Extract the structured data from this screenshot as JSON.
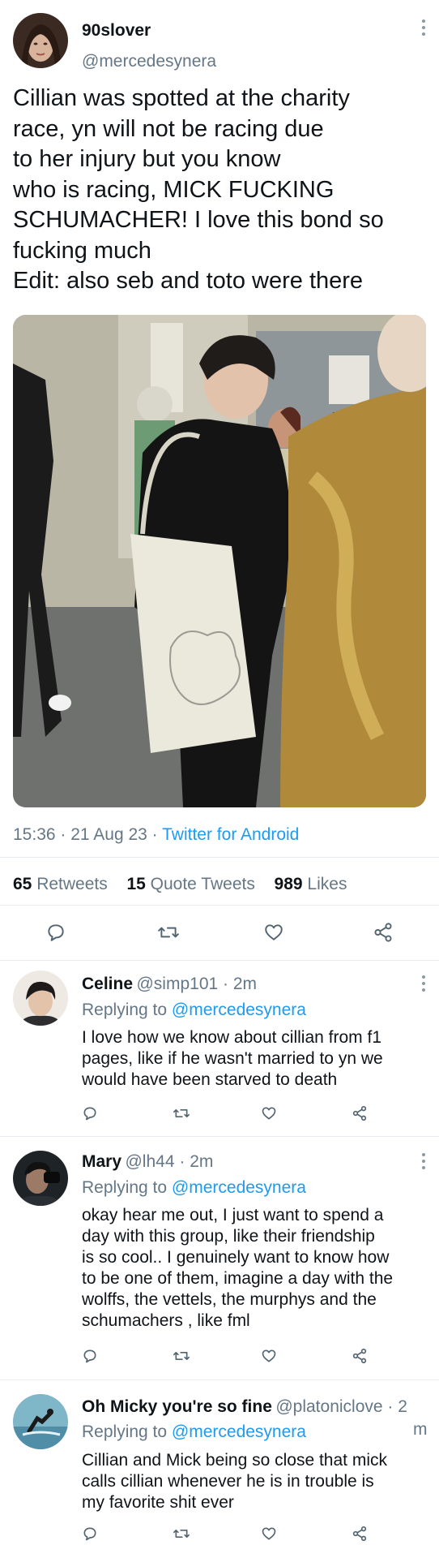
{
  "tweet": {
    "display_name": "90slover",
    "handle": "@mercedesynera",
    "text_lines": [
      "Cillian was spotted at the charity",
      "race, yn will not be racing due",
      "to her injury but you know",
      "who is racing, MICK FUCKING",
      "SCHUMACHER! I love this bond so",
      "fucking much",
      "Edit: also seb and toto were there"
    ],
    "time": "15:36",
    "date": "21 Aug 23",
    "source": "Twitter for Android",
    "retweets": "65",
    "retweets_label": "Retweets",
    "quotes": "15",
    "quotes_label": "Quote Tweets",
    "likes": "989",
    "likes_label": "Likes"
  },
  "replies": [
    {
      "name": "Celine",
      "handle": "@simp101",
      "time": "2m",
      "replying_label": "Replying to",
      "replying_to": "@mercedesynera",
      "lines": [
        "I love how we know about cillian from f1",
        "pages, like if he wasn't married to yn we",
        "would have been starved to death"
      ]
    },
    {
      "name": "Mary",
      "handle": "@lh44",
      "time": "2m",
      "replying_label": "Replying to",
      "replying_to": "@mercedesynera",
      "lines": [
        "okay hear me out, I just want to spend a",
        "day with this group, like their friendship",
        "is so cool.. I genuinely want to know how",
        "to be one of them, imagine a day with the",
        "wolffs, the vettels, the murphys and the",
        "schumachers , like fml"
      ]
    },
    {
      "name": "Oh Micky you're so fine",
      "handle": "@platoniclove",
      "time": "2",
      "time_wrap": "m",
      "replying_label": "Replying to",
      "replying_to": "@mercedesynera",
      "lines": [
        "Cillian and Mick being so close that mick",
        "calls cillian whenever he is in trouble is",
        "my favorite shit ever"
      ]
    }
  ],
  "colors": {
    "link": "#1d9bf0",
    "muted": "#657786",
    "text": "#0f1419"
  },
  "icons": [
    "reply-icon",
    "retweet-icon",
    "like-icon",
    "share-icon",
    "more-icon"
  ]
}
